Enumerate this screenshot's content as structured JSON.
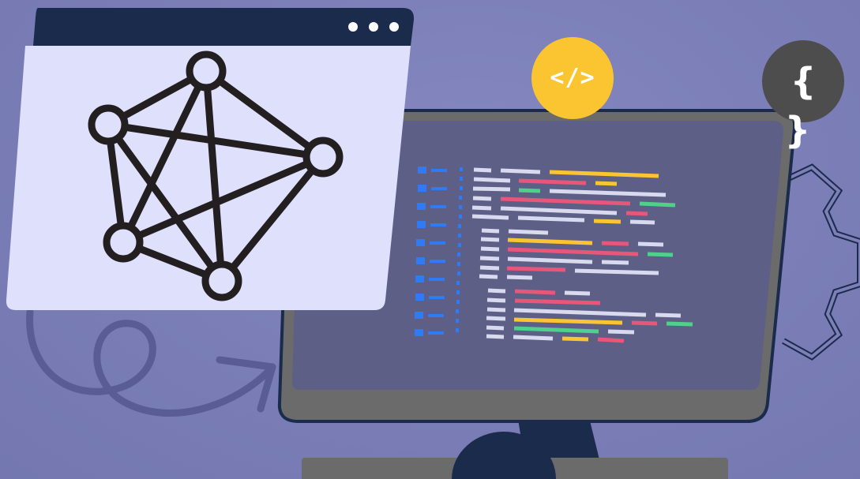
{
  "scene": {
    "colors": {
      "background": "#7d80b8",
      "window_titlebar": "#1b2b4b",
      "window_body": "#dfe0fb",
      "network_graph": "#231f20",
      "monitor_frame": "#6b6b6b",
      "monitor_screen": "#5d5f86",
      "monitor_stand": "#1b2b4b",
      "keyboard": "#6b6b6b",
      "code_badge": "#fbc531",
      "brace_badge": "#4d4d4d",
      "gear_outline": "#1b2b4b",
      "arrow": "#595c95",
      "code_blue": "#2f7bf5",
      "code_white": "#d9daf0",
      "code_yellow": "#fbc531",
      "code_red": "#e8577a",
      "code_green": "#4fd18b"
    },
    "window": {
      "titlebar_dots": [
        "dot",
        "dot",
        "dot"
      ],
      "content_icon": "network-graph-icon"
    },
    "badges": {
      "code_tag": "</>",
      "braces": "{ }"
    },
    "decorations": [
      "gear-outline-icon",
      "curly-arrow-icon"
    ]
  }
}
